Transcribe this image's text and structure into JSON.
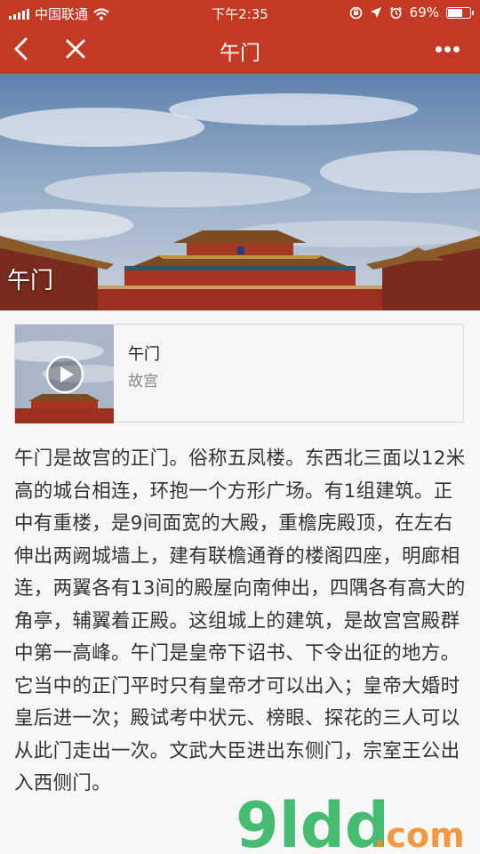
{
  "status_bar": {
    "carrier": "中国联通",
    "time": "下午2:35",
    "battery": "69%",
    "battery_level": 0.69
  },
  "nav": {
    "title": "午门"
  },
  "hero": {
    "caption": "午门"
  },
  "audio_card": {
    "title": "午门",
    "subtitle": "故宫"
  },
  "article": {
    "text": "午门是故宫的正门。俗称五凤楼。东西北三面以12米高的城台相连，环抱一个方形广场。有1组建筑。正中有重楼，是9间面宽的大殿，重檐庑殿顶，在左右伸出两阙城墙上，建有联檐通脊的楼阁四座，明廊相连，两翼各有13间的殿屋向南伸出，四隅各有高大的角亭，辅翼着正殿。这组城上的建筑，是故宫宫殿群中第一高峰。午门是皇帝下诏书、下令出征的地方。它当中的正门平时只有皇帝才可以出入；皇帝大婚时皇后进一次；殿试考中状元、榜眼、探花的三人可以从此门走出一次。文武大臣进出东侧门，宗室王公出入西侧门。"
  },
  "watermark": {
    "brand": "9ldd",
    "suffix": ".com"
  },
  "colors": {
    "header": "#c23a24",
    "nav_button": "#3d8fd6",
    "watermark_green": "#2db55d",
    "watermark_orange": "#f28c28"
  }
}
